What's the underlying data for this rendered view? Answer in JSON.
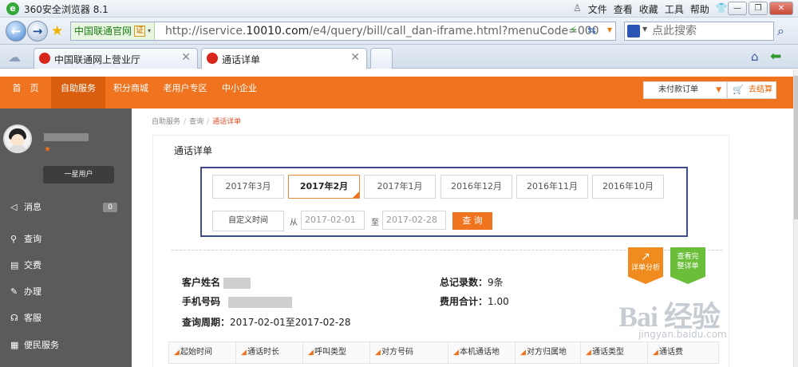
{
  "browser": {
    "title": "360安全浏览器 8.1",
    "menu": [
      "文件",
      "查看",
      "收藏",
      "工具",
      "帮助"
    ],
    "site_name": "中国联通官网",
    "cert_label": "证",
    "url_prefix": "http://iservice.",
    "url_domain": "10010.com",
    "url_suffix": "/e4/query/bill/call_dan-iframe.html?menuCode=000",
    "search_placeholder": "点此搜索",
    "tabs": [
      {
        "label": "中国联通网上营业厅"
      },
      {
        "label": "通话详单"
      }
    ]
  },
  "topnav": {
    "items": [
      "首　页",
      "自助服务",
      "积分商城",
      "老用户专区",
      "中小企业"
    ],
    "unpaid_orders": "未付款订单",
    "cart": "去结算"
  },
  "sidebar": {
    "level": "一星用户",
    "items": [
      {
        "label": "消息",
        "count": "0"
      },
      {
        "label": "查询"
      },
      {
        "label": "交费"
      },
      {
        "label": "办理"
      },
      {
        "label": "客服"
      },
      {
        "label": "便民服务"
      }
    ]
  },
  "breadcrumb": {
    "items": [
      "自助服务",
      "查询"
    ],
    "current": "通话详单"
  },
  "panel": {
    "title": "通话详单",
    "months": [
      "2017年3月",
      "2017年2月",
      "2017年1月",
      "2016年12月",
      "2016年11月",
      "2016年10月"
    ],
    "selected_month": "2017年2月",
    "custom_label": "自定义时间",
    "from_label": "从",
    "from_date": "2017-02-01",
    "to_label": "至",
    "to_date": "2017-02-28",
    "query_label": "查 询",
    "analysis_label": "详单分析",
    "full_label": "查看完整详单"
  },
  "customer": {
    "name_label": "客户姓名",
    "phone_label": "手机号码",
    "period_label": "查询周期：",
    "period_value": "2017-02-01至2017-02-28",
    "total_records_label": "总记录数：",
    "total_records_value": "9条",
    "total_fee_label": "费用合计：",
    "total_fee_value": "1.00"
  },
  "table": {
    "headers": [
      "起始时间",
      "通话时长",
      "呼叫类型",
      "对方号码",
      "本机通话地",
      "对方归属地",
      "通话类型",
      "通话费"
    ]
  },
  "watermark": {
    "main": "Bai 经验",
    "sub": "jingyan.baidu.com"
  }
}
